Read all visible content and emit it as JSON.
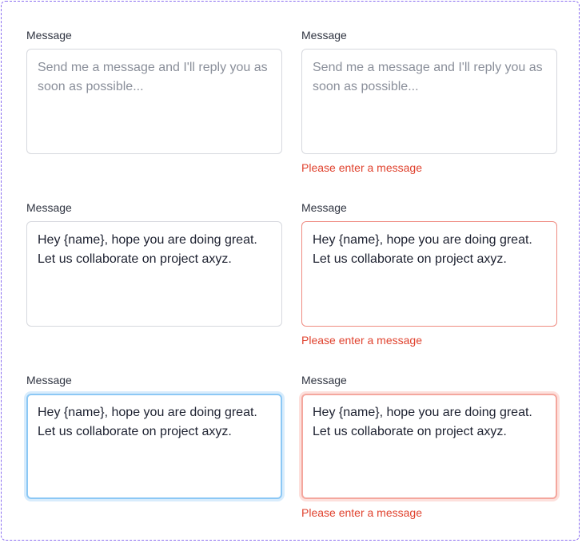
{
  "fields": [
    {
      "label": "Message",
      "placeholder": "Send me a message and I'll reply you as soon as possible...",
      "value": "",
      "error": ""
    },
    {
      "label": "Message",
      "placeholder": "Send me a message and I'll reply you as soon as possible...",
      "value": "",
      "error": "Please enter a message"
    },
    {
      "label": "Message",
      "placeholder": "",
      "value": "Hey {name}, hope you are doing great. Let us collaborate on project axyz.",
      "error": ""
    },
    {
      "label": "Message",
      "placeholder": "",
      "value": "Hey {name}, hope you are doing great. Let us collaborate on project axyz.",
      "error": "Please enter a message"
    },
    {
      "label": "Message",
      "placeholder": "",
      "value": "Hey {name}, hope you are doing great. Let us collaborate on project axyz.",
      "error": ""
    },
    {
      "label": "Message",
      "placeholder": "",
      "value": "Hey {name}, hope you are doing great. Let us collaborate on project axyz.",
      "error": "Please enter a message"
    }
  ],
  "colors": {
    "frame_border": "#8b6ff0",
    "default_border": "#d6d8de",
    "error_text": "#e0432f",
    "error_border": "#ef8b81",
    "focus_border": "#8cc8f5"
  }
}
